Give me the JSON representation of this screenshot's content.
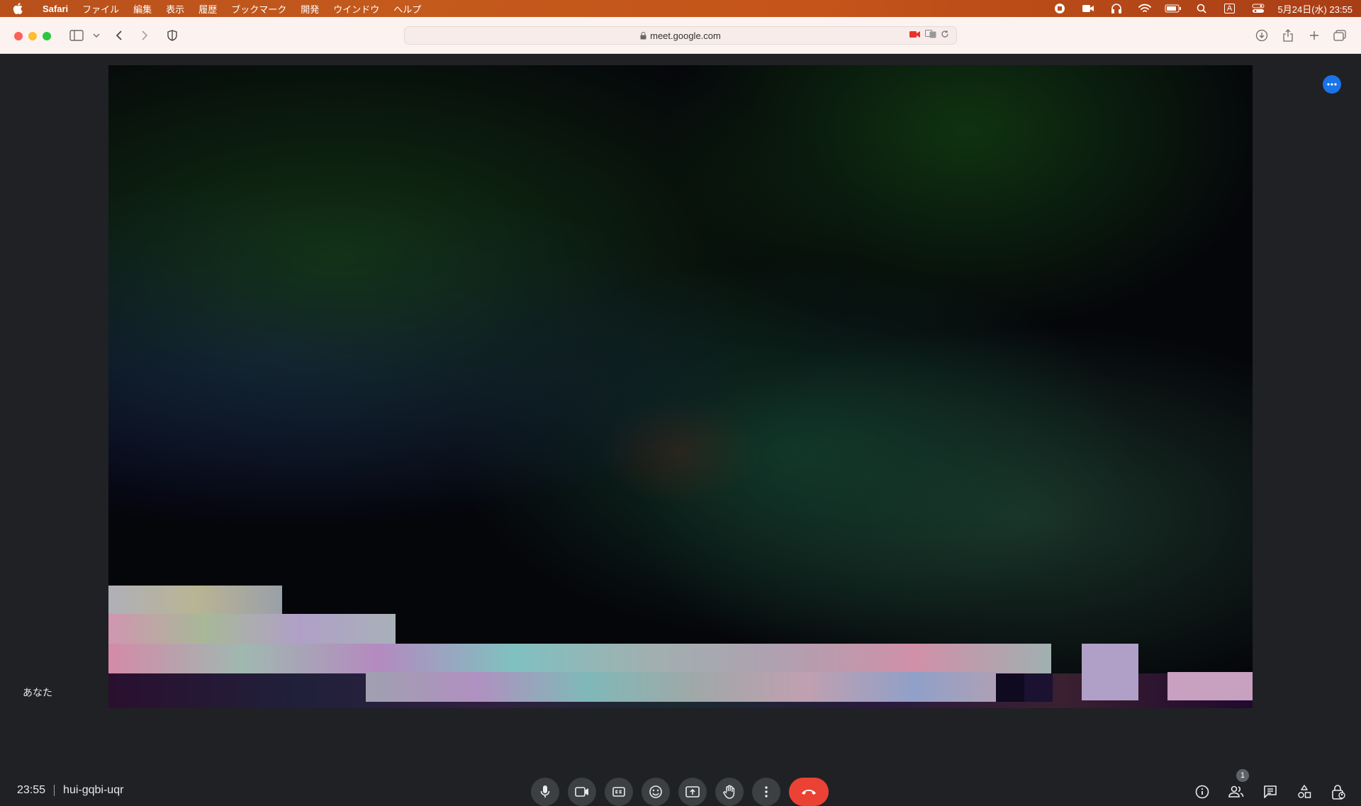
{
  "menubar": {
    "app_name": "Safari",
    "items": [
      "ファイル",
      "編集",
      "表示",
      "履歴",
      "ブックマーク",
      "開発",
      "ウインドウ",
      "ヘルプ"
    ],
    "input_mode": "A",
    "clock": "5月24日(水)  23:55"
  },
  "browser": {
    "url": "meet.google.com"
  },
  "meet": {
    "self_label": "あなた",
    "time": "23:55",
    "meeting_code": "hui-gqbi-uqr",
    "participants_count": "1",
    "accent_color": "#1a73e8",
    "hangup_color": "#ea4335"
  }
}
